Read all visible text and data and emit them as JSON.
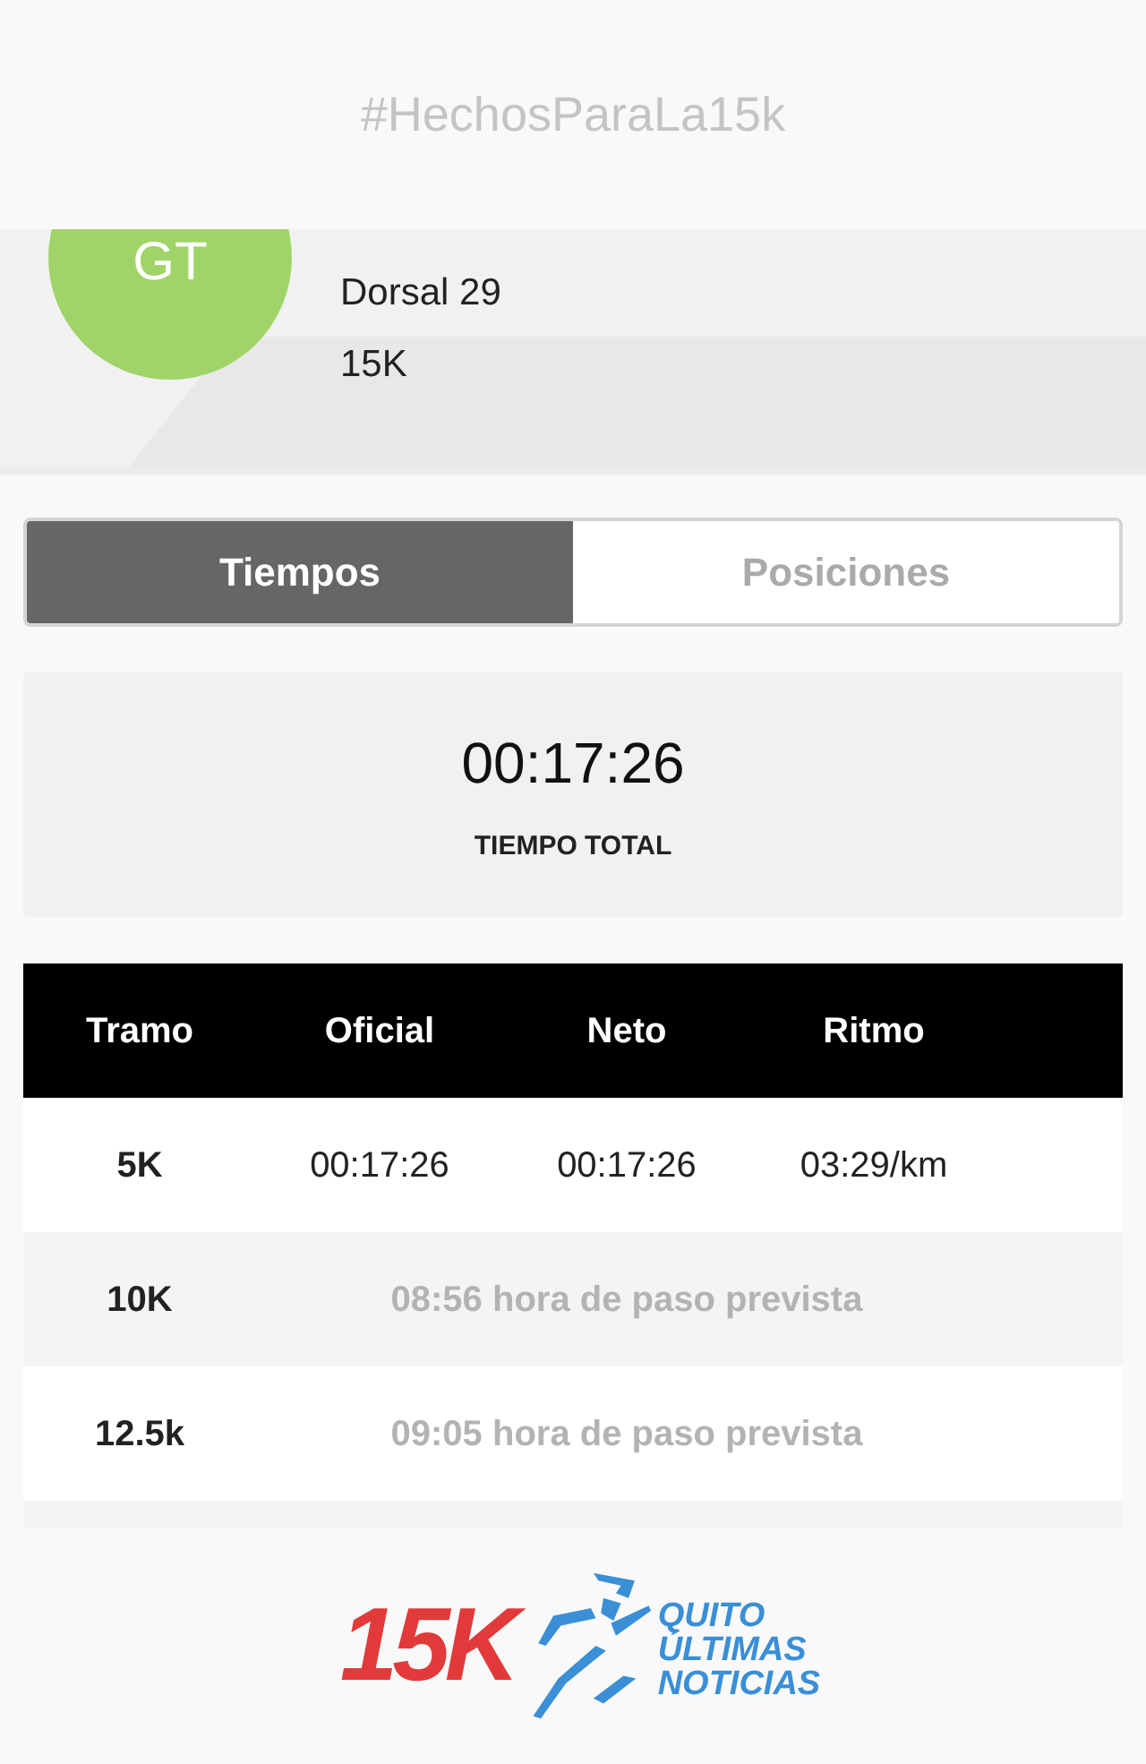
{
  "header": {
    "hashtag": "#HechosParaLa15k"
  },
  "runner": {
    "initials": "GT",
    "bib": "Dorsal 29",
    "race": "15K"
  },
  "tabs": [
    {
      "label": "Tiempos",
      "selected": true
    },
    {
      "label": "Posiciones",
      "selected": false
    }
  ],
  "total": {
    "time": "00:17:26",
    "label": "TIEMPO TOTAL"
  },
  "table": {
    "columns": [
      "Tramo",
      "Oficial",
      "Neto",
      "Ritmo"
    ],
    "rows": [
      {
        "kind": "split",
        "segment": "5K",
        "official": "00:17:26",
        "net": "00:17:26",
        "pace": "03:29/km"
      },
      {
        "kind": "forecast",
        "segment": "10K",
        "note": "08:56 hora de paso prevista"
      },
      {
        "kind": "forecast",
        "segment": "12.5k",
        "note": "09:05 hora de paso prevista"
      }
    ]
  },
  "footer": {
    "logo": {
      "number": "15K",
      "lines": [
        "QUITO",
        "ÚLTIMAS",
        "NOTICIAS"
      ]
    }
  }
}
